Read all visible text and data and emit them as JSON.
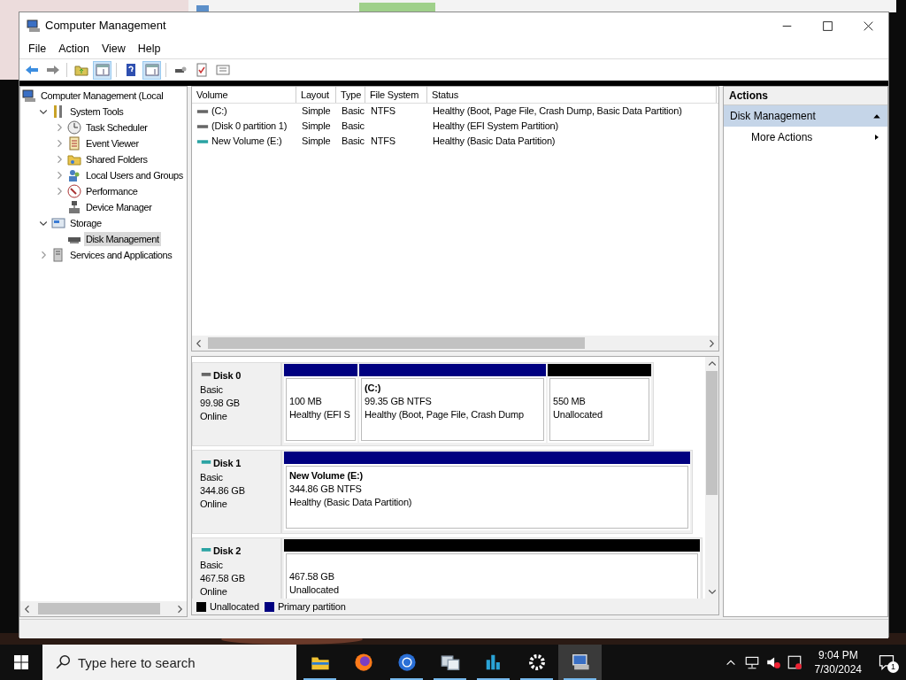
{
  "window": {
    "title": "Computer Management"
  },
  "menu": [
    "File",
    "Action",
    "View",
    "Help"
  ],
  "toolbar": [
    {
      "kind": "back",
      "pressed": false
    },
    {
      "kind": "forward",
      "pressed": false
    },
    {
      "kind": "up",
      "pressed": false
    },
    {
      "kind": "tree-pane",
      "pressed": true
    },
    {
      "kind": "help",
      "pressed": false
    },
    {
      "kind": "action-pane",
      "pressed": true
    },
    {
      "kind": "key",
      "pressed": false
    },
    {
      "kind": "check",
      "pressed": false
    },
    {
      "kind": "list",
      "pressed": false
    }
  ],
  "tree": [
    {
      "label": "Computer Management (Local",
      "kind": "computer",
      "selected": false,
      "children": [
        {
          "label": "System Tools",
          "kind": "tools",
          "expanded": true,
          "selected": false,
          "children": [
            {
              "label": "Task Scheduler",
              "kind": "clock",
              "expanded": false,
              "selected": false
            },
            {
              "label": "Event Viewer",
              "kind": "event",
              "expanded": false,
              "selected": false
            },
            {
              "label": "Shared Folders",
              "kind": "share",
              "expanded": false,
              "selected": false
            },
            {
              "label": "Local Users and Groups",
              "kind": "users",
              "expanded": false,
              "selected": false
            },
            {
              "label": "Performance",
              "kind": "perf",
              "expanded": false,
              "selected": false
            },
            {
              "label": "Device Manager",
              "kind": "device",
              "selected": false
            }
          ]
        },
        {
          "label": "Storage",
          "kind": "storage",
          "expanded": true,
          "selected": false,
          "children": [
            {
              "label": "Disk Management",
              "kind": "disk",
              "selected": true
            }
          ]
        },
        {
          "label": "Services and Applications",
          "kind": "services",
          "expanded": false,
          "selected": false
        }
      ]
    }
  ],
  "volumes": {
    "columns": [
      "Volume",
      "Layout",
      "Type",
      "File System",
      "Status"
    ],
    "rows": [
      {
        "kind": "system",
        "volume": "(C:)",
        "layout": "Simple",
        "type": "Basic",
        "file_system": "NTFS",
        "status": "Healthy (Boot, Page File, Crash Dump, Basic Data Partition)"
      },
      {
        "kind": "system",
        "volume": "(Disk 0 partition 1)",
        "layout": "Simple",
        "type": "Basic",
        "status": "Healthy (EFI System Partition)"
      },
      {
        "kind": "data",
        "volume": "New Volume (E:)",
        "layout": "Simple",
        "type": "Basic",
        "file_system": "NTFS",
        "status": "Healthy (Basic Data Partition)"
      }
    ]
  },
  "disks": [
    {
      "name": "Disk 0",
      "kind": "system",
      "type": "Basic",
      "size": "99.98 GB",
      "state": "Online",
      "partitions": [
        {
          "kind": "primary",
          "size": "100 MB",
          "status": "Healthy (EFI S"
        },
        {
          "kind": "primary",
          "title": "(C:)",
          "size": "99.35 GB NTFS",
          "status": "Healthy (Boot, Page File, Crash Dump"
        },
        {
          "kind": "unallocated",
          "size": "550 MB",
          "status": "Unallocated"
        }
      ]
    },
    {
      "name": "Disk 1",
      "kind": "data",
      "type": "Basic",
      "size": "344.86 GB",
      "state": "Online",
      "partitions": [
        {
          "kind": "primary",
          "title": "New Volume  (E:)",
          "size": "344.86 GB NTFS",
          "status": "Healthy (Basic Data Partition)"
        }
      ]
    },
    {
      "name": "Disk 2",
      "kind": "data",
      "type": "Basic",
      "size": "467.58 GB",
      "state": "Online",
      "partitions": [
        {
          "kind": "unallocated",
          "size": "467.58 GB",
          "status": "Unallocated"
        }
      ]
    }
  ],
  "legend": [
    {
      "kind": "unallocated",
      "label": "Unallocated"
    },
    {
      "kind": "primary",
      "label": "Primary partition"
    }
  ],
  "actions": {
    "header": "Actions",
    "groups": [
      {
        "title": "Disk Management",
        "expanded": true,
        "items": [
          "More Actions"
        ]
      }
    ]
  },
  "taskbar": {
    "search": {
      "placeholder": "Type here to search"
    },
    "apps": [
      {
        "kind": "explorer",
        "running": true,
        "selected": false
      },
      {
        "kind": "firefox",
        "running": false,
        "selected": false
      },
      {
        "kind": "browser",
        "running": true,
        "selected": false
      },
      {
        "kind": "network",
        "running": true,
        "selected": false
      },
      {
        "kind": "chart",
        "running": true,
        "selected": false
      },
      {
        "kind": "settings",
        "running": true,
        "selected": false
      },
      {
        "kind": "management",
        "running": true,
        "selected": true
      }
    ],
    "time": "9:04 PM",
    "date": "7/30/2024",
    "notifications": "1"
  }
}
